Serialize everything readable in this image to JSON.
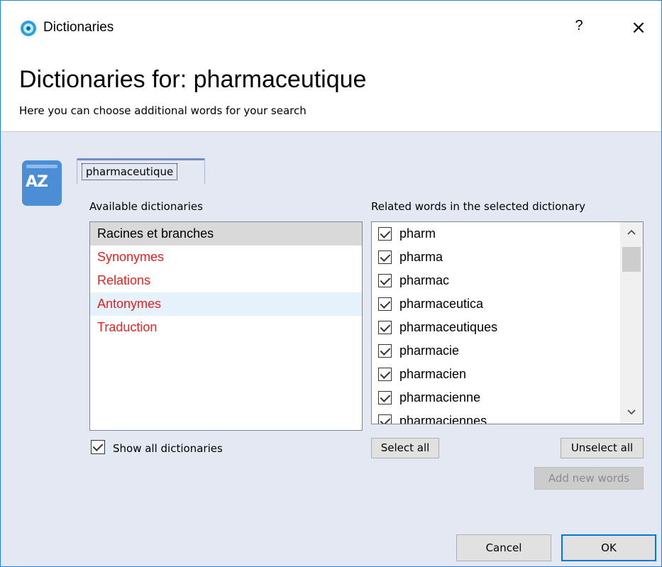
{
  "window": {
    "title": "Dictionaries",
    "help_label": "?",
    "close_label": "×"
  },
  "header": {
    "title": "Dictionaries for: pharmaceutique",
    "subtitle": "Here you can choose additional words for your search"
  },
  "icon": {
    "name": "dictionary-az-icon",
    "glyph": "AZ",
    "color": "#4c8ed6"
  },
  "word_tab": {
    "label": "pharmaceutique"
  },
  "dictionaries": {
    "label": "Available dictionaries",
    "items": [
      {
        "label": "Racines et branches",
        "state": "selected"
      },
      {
        "label": "Synonymes",
        "state": "red"
      },
      {
        "label": "Relations",
        "state": "red"
      },
      {
        "label": "Antonymes",
        "state": "red-hover"
      },
      {
        "label": "Traduction",
        "state": "red"
      }
    ],
    "show_all_label": "Show all dictionaries",
    "show_all_checked": true
  },
  "related_words": {
    "label": "Related words in the selected dictionary",
    "items": [
      {
        "word": "pharm",
        "checked": true
      },
      {
        "word": "pharma",
        "checked": true
      },
      {
        "word": "pharmac",
        "checked": true
      },
      {
        "word": "pharmaceutica",
        "checked": true
      },
      {
        "word": "pharmaceutiques",
        "checked": true
      },
      {
        "word": "pharmacie",
        "checked": true
      },
      {
        "word": "pharmacien",
        "checked": true
      },
      {
        "word": "pharmacienne",
        "checked": true
      },
      {
        "word": "pharmaciennes",
        "checked": true
      }
    ],
    "scroll_up_icon": "chevron-up-icon",
    "scroll_down_icon": "chevron-down-icon"
  },
  "buttons": {
    "select_all": "Select all",
    "unselect_all": "Unselect all",
    "add_new_words": "Add new words",
    "cancel": "Cancel",
    "ok": "OK"
  },
  "colors": {
    "accent": "#2b7fd6",
    "red_text": "#e8211f",
    "panel_bg": "#e3e8f3"
  }
}
